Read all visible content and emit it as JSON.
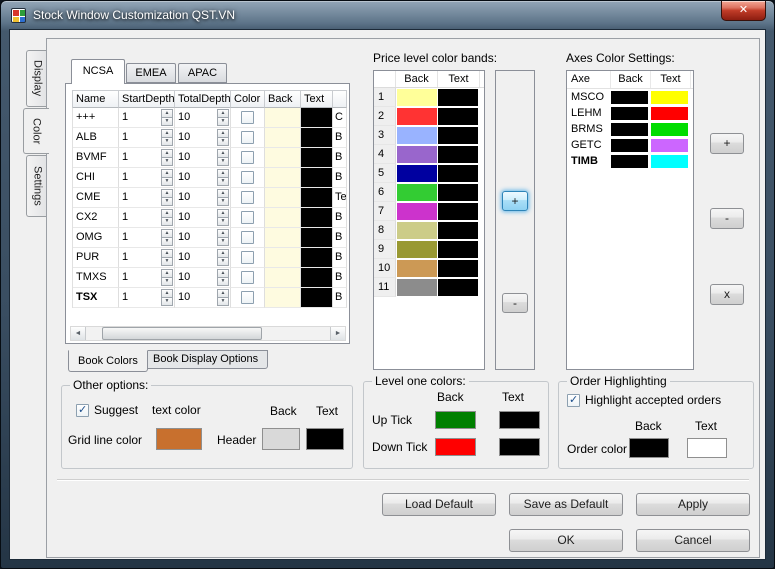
{
  "window": {
    "title": "Stock Window Customization QST.VN"
  },
  "icons": {
    "close": "✕",
    "check": "✓",
    "spin_up": "▲",
    "spin_down": "▼",
    "scroll_left": "◄",
    "scroll_right": "►"
  },
  "side_tabs": [
    {
      "label": "Display"
    },
    {
      "label": "Color"
    },
    {
      "label": "Settings"
    }
  ],
  "exchange_tabs": [
    {
      "label": "NCSA"
    },
    {
      "label": "EMEA"
    },
    {
      "label": "APAC"
    }
  ],
  "book_table": {
    "headers": [
      "Name",
      "StartDepth",
      "TotalDepth",
      "Color",
      "Back",
      "Text"
    ],
    "rows": [
      {
        "name": "+++",
        "start": "1",
        "total": "10",
        "back": "#fefbe0",
        "text": "#000000",
        "partial": "C",
        "weight": "normal"
      },
      {
        "name": "ALB",
        "start": "1",
        "total": "10",
        "back": "#fefbe0",
        "text": "#000000",
        "partial": "B",
        "weight": "normal"
      },
      {
        "name": "BVMF",
        "start": "1",
        "total": "10",
        "back": "#fefbe0",
        "text": "#000000",
        "partial": "B",
        "weight": "normal"
      },
      {
        "name": "CHI",
        "start": "1",
        "total": "10",
        "back": "#fefbe0",
        "text": "#000000",
        "partial": "B",
        "weight": "normal"
      },
      {
        "name": "CME",
        "start": "1",
        "total": "10",
        "back": "#fefbe0",
        "text": "#000000",
        "partial": "Te",
        "weight": "normal"
      },
      {
        "name": "CX2",
        "start": "1",
        "total": "10",
        "back": "#fefbe0",
        "text": "#000000",
        "partial": "B",
        "weight": "normal"
      },
      {
        "name": "OMG",
        "start": "1",
        "total": "10",
        "back": "#fefbe0",
        "text": "#000000",
        "partial": "B",
        "weight": "normal"
      },
      {
        "name": "PUR",
        "start": "1",
        "total": "10",
        "back": "#fefbe0",
        "text": "#000000",
        "partial": "B",
        "weight": "normal"
      },
      {
        "name": "TMXS",
        "start": "1",
        "total": "10",
        "back": "#fefbe0",
        "text": "#000000",
        "partial": "B",
        "weight": "normal"
      },
      {
        "name": "TSX",
        "start": "1",
        "total": "10",
        "back": "#fefbe0",
        "text": "#000000",
        "partial": "B",
        "weight": "bold"
      }
    ]
  },
  "book_tabs": [
    {
      "label": "Book Colors"
    },
    {
      "label": "Book Display Options"
    }
  ],
  "price_bands": {
    "title": "Price level color bands:",
    "back_header": "Back",
    "text_header": "Text",
    "add_label": "+",
    "remove_label": "-",
    "rows": [
      {
        "num": "1",
        "back": "#ffff99",
        "text": "#000000"
      },
      {
        "num": "2",
        "back": "#ff3333",
        "text": "#000000"
      },
      {
        "num": "3",
        "back": "#99b3ff",
        "text": "#000000"
      },
      {
        "num": "4",
        "back": "#9966cc",
        "text": "#000000"
      },
      {
        "num": "5",
        "back": "#0000a0",
        "text": "#000000"
      },
      {
        "num": "6",
        "back": "#33cc33",
        "text": "#000000"
      },
      {
        "num": "7",
        "back": "#cc33cc",
        "text": "#000000"
      },
      {
        "num": "8",
        "back": "#cccc88",
        "text": "#000000"
      },
      {
        "num": "9",
        "back": "#999933",
        "text": "#000000"
      },
      {
        "num": "10",
        "back": "#cc9955",
        "text": "#000000"
      },
      {
        "num": "11",
        "back": "#8c8c8c",
        "text": "#000000"
      }
    ]
  },
  "axes": {
    "title": "Axes Color Settings:",
    "axe_header": "Axe",
    "back_header": "Back",
    "text_header": "Text",
    "add_label": "+",
    "remove_label": "-",
    "delete_label": "x",
    "rows": [
      {
        "axe": "MSCO",
        "back": "#000000",
        "text": "#ffff00",
        "weight": "normal"
      },
      {
        "axe": "LEHM",
        "back": "#000000",
        "text": "#ff0000",
        "weight": "normal"
      },
      {
        "axe": "BRMS",
        "back": "#000000",
        "text": "#00dd00",
        "weight": "normal"
      },
      {
        "axe": "GETC",
        "back": "#000000",
        "text": "#cc66ff",
        "weight": "normal"
      },
      {
        "axe": "TIMB",
        "back": "#000000",
        "text": "#00ffff",
        "weight": "bold"
      }
    ]
  },
  "other_options": {
    "title": "Other options:",
    "suggest_label": "Suggest",
    "suggest_suffix": "text color",
    "grid_line_label": "Grid line color",
    "grid_line_color": "#c8702e",
    "header_label": "Header",
    "back_header": "Back",
    "text_header": "Text",
    "header_back": "#d9d9d9",
    "header_text": "#000000"
  },
  "level_one": {
    "title": "Level one colors:",
    "back_header": "Back",
    "text_header": "Text",
    "rows": [
      {
        "label": "Up Tick",
        "back": "#008000",
        "text": "#000000"
      },
      {
        "label": "Down Tick",
        "back": "#ff0000",
        "text": "#000000"
      }
    ]
  },
  "order_highlighting": {
    "title": "Order Highlighting",
    "checkbox_label": "Highlight accepted orders",
    "back_header": "Back",
    "text_header": "Text",
    "order_color_label": "Order color",
    "back": "#000000",
    "text": "#ffffff"
  },
  "action_buttons": {
    "load_default": "Load Default",
    "save_as_default": "Save as Default",
    "apply": "Apply",
    "ok": "OK",
    "cancel": "Cancel"
  }
}
